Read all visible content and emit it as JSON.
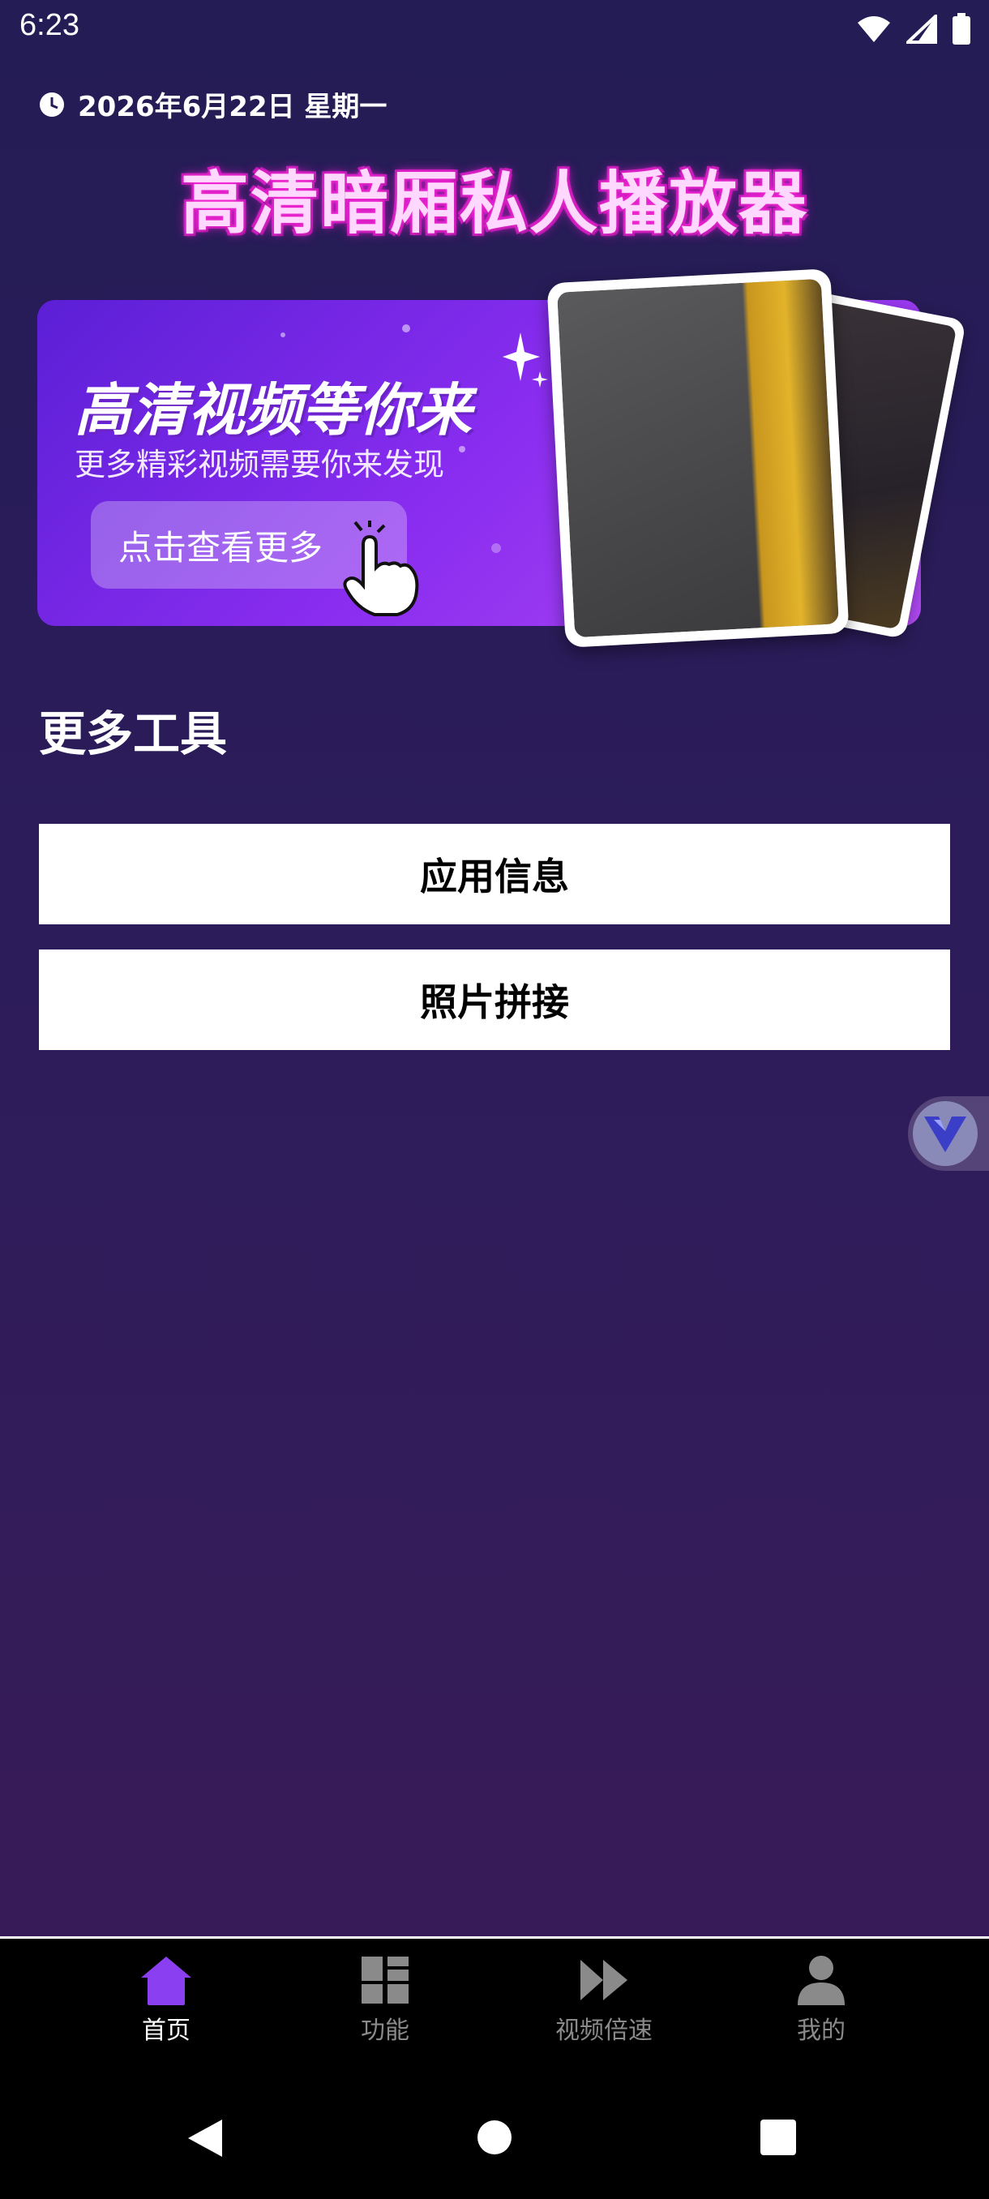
{
  "status_bar": {
    "time": "6:23"
  },
  "header": {
    "date": "2026年6月22日 星期一",
    "app_title": "高清暗厢私人播放器"
  },
  "banner": {
    "headline": "高清视频等你来",
    "subtitle": "更多精彩视频需要你来发现",
    "button_label": "点击查看更多"
  },
  "tools": {
    "section_title": "更多工具",
    "buttons": [
      "应用信息",
      "照片拼接"
    ]
  },
  "bottom_nav": {
    "items": [
      {
        "label": "首页",
        "icon": "home-icon",
        "active": true
      },
      {
        "label": "功能",
        "icon": "grid-icon",
        "active": false
      },
      {
        "label": "视频倍速",
        "icon": "fast-forward-icon",
        "active": false
      },
      {
        "label": "我的",
        "icon": "person-icon",
        "active": false
      }
    ]
  },
  "colors": {
    "accent": "#8a3ff0",
    "background_top": "#241c55",
    "background_bottom": "#3a1b58"
  }
}
